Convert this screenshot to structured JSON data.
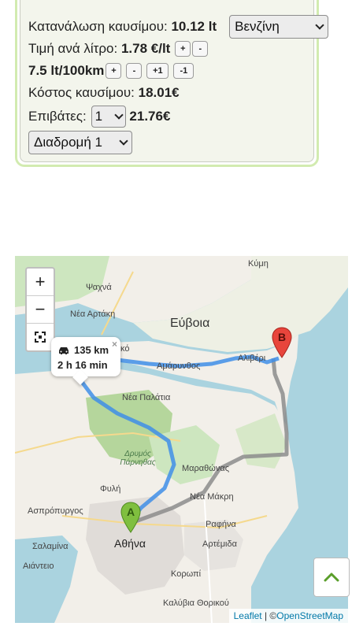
{
  "fuel": {
    "consumption_label": "Κατανάλωση καυσίμου:",
    "consumption_value": "10.12 lt",
    "fuel_type": "Βενζίνη",
    "price_label": "Τιμή ανά λίτρο:",
    "price_value": "1.78 €/lt",
    "price_plus": "+",
    "price_minus": "-",
    "rate_value": "7.5 lt/100km",
    "rate_plus": "+",
    "rate_minus": "-",
    "rate_plus1": "+1",
    "rate_minus1": "-1",
    "cost_label": "Κόστος καυσίμου:",
    "cost_value": "18.01€",
    "passengers_label": "Επιβάτες:",
    "passengers_value": "1",
    "per_person_value": "21.76€",
    "route_select": "Διαδρομή 1"
  },
  "map": {
    "zoom_in": "+",
    "zoom_out": "−",
    "popup_distance": "135 km",
    "popup_time": "2 h 16 min",
    "popup_close": "×",
    "marker_a": "A",
    "marker_b": "B",
    "attribution_leaflet": "Leaflet",
    "attribution_sep": " | ©",
    "attribution_osm": "OpenStreetMap",
    "labels": {
      "kymi": "Κύμη",
      "psachna": "Ψαχνά",
      "nea_artaki": "Νέα Αρτάκη",
      "evia": "Εύβοια",
      "chalkida_partial": "κό",
      "amarynthos": "Αμάρυνθος",
      "aliveri": "Αλιβέρι",
      "nea_palatia": "Νέα Παλάτια",
      "parnitha": "Δρυμός Πάρνηθας",
      "marathonas": "Μαραθώνας",
      "nea_makri": "Νέα Μάκρη",
      "fyli": "Φυλή",
      "aspropyrgos": "Ασπρόπυργος",
      "athina": "Αθήνα",
      "rafina": "Ραφήνα",
      "salamina": "Σαλαμίνα",
      "artemida": "Αρτέμιδα",
      "aiantio": "Αιάντειο",
      "koropi": "Κορωπί",
      "kalyvia": "Καλύβια Θορικού"
    }
  },
  "colors": {
    "route_main": "#3f8ee8",
    "route_alt": "#8c8c8c",
    "marker_a": "#7fbf3f",
    "marker_b": "#e8453c",
    "panel_border": "#d2ebb0",
    "scroll_arrow": "#5a9e2a"
  }
}
